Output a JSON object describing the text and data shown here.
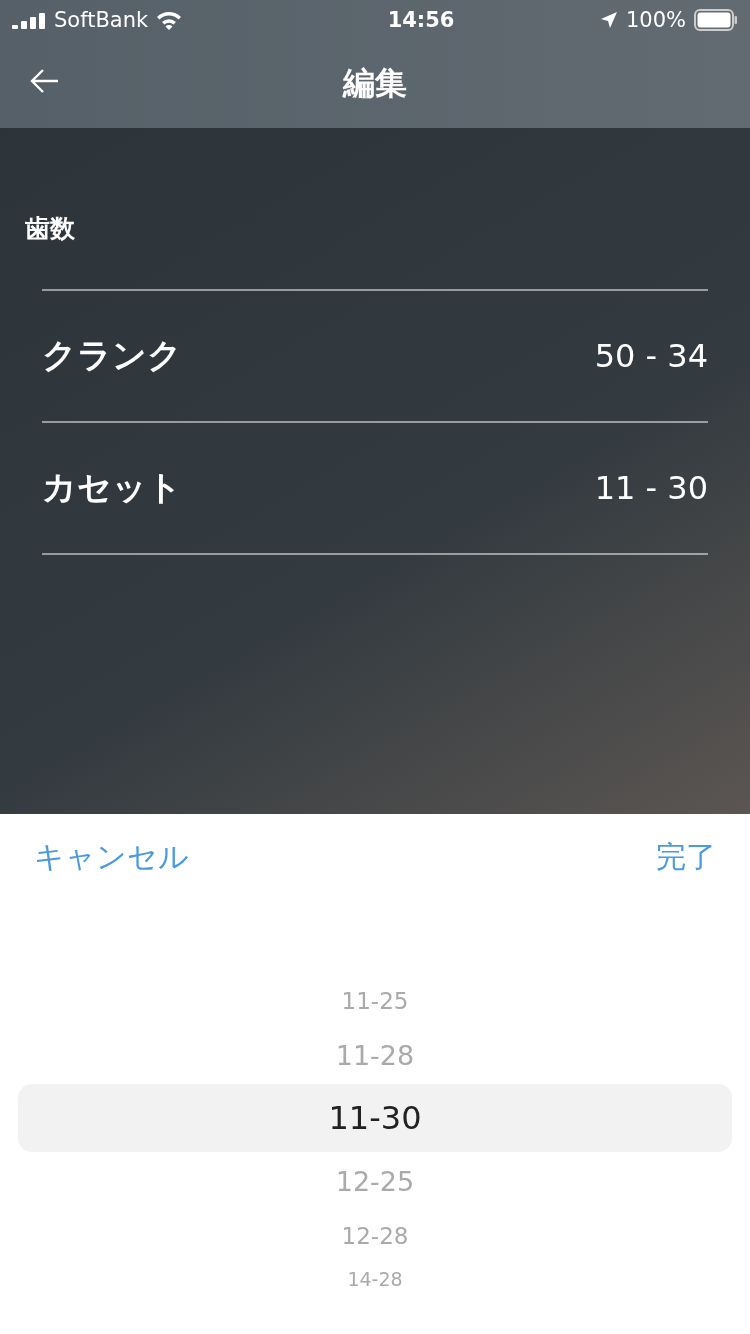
{
  "status_bar": {
    "carrier": "SoftBank",
    "time": "14:56",
    "battery": "100%"
  },
  "nav": {
    "title": "編集"
  },
  "section": {
    "title": "歯数"
  },
  "rows": [
    {
      "label": "クランク",
      "value": "50 - 34"
    },
    {
      "label": "カセット",
      "value": "11 - 30"
    }
  ],
  "toolbar": {
    "cancel": "キャンセル",
    "done": "完了"
  },
  "picker": [
    {
      "label": "11-25",
      "selected": false
    },
    {
      "label": "11-28",
      "selected": false
    },
    {
      "label": "11-30",
      "selected": true
    },
    {
      "label": "12-25",
      "selected": false
    },
    {
      "label": "12-28",
      "selected": false
    },
    {
      "label": "14-28",
      "selected": false
    }
  ]
}
